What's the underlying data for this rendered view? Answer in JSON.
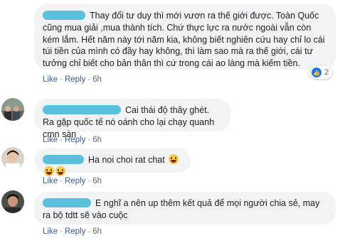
{
  "comments": [
    {
      "text": "Thay đổi tư duy thì mới vươn ra thế giới được. Toàn Quốc cũng mua giải ,mua thành tích. Chứ thực lực ra nước ngoài vẫn còn kém lắm. Hết năm này tới năm kia, không biết nghiên cứu hay chỉ lo cái túi tiền của mình có đầy hay không, thì làm sao mà ra thế giới, cái tư tưởng chỉ biết cho bản thân thì cứ trong cái ao làng mà kiếm tiền.",
      "like": "Like",
      "reply": "Reply",
      "time": "6h",
      "reaction_count": "2"
    },
    {
      "text": "Cai thái độ thây ghét. Ra gặp quốc tế nó oánh cho lại chạy quanh cmn sàn",
      "like": "Like",
      "reply": "Reply",
      "time": "6h"
    },
    {
      "text": "Ha noi choi rat chat",
      "like": "Like",
      "reply": "Reply",
      "time": "6h"
    },
    {
      "text": "E nghĩ a nên up thêm kết quả để mọi người chia sẻ, may ra bộ tdtt sẽ vào cuộc",
      "like": "Like",
      "reply": "Reply",
      "time": "6h"
    }
  ],
  "colors": {
    "bubble": "#f2f3f5",
    "link": "#385898",
    "name_blur": "#5bc0de",
    "like_icon": "#1877f2"
  },
  "icons": [
    "like-icon",
    "laughing-emoji-icon"
  ]
}
